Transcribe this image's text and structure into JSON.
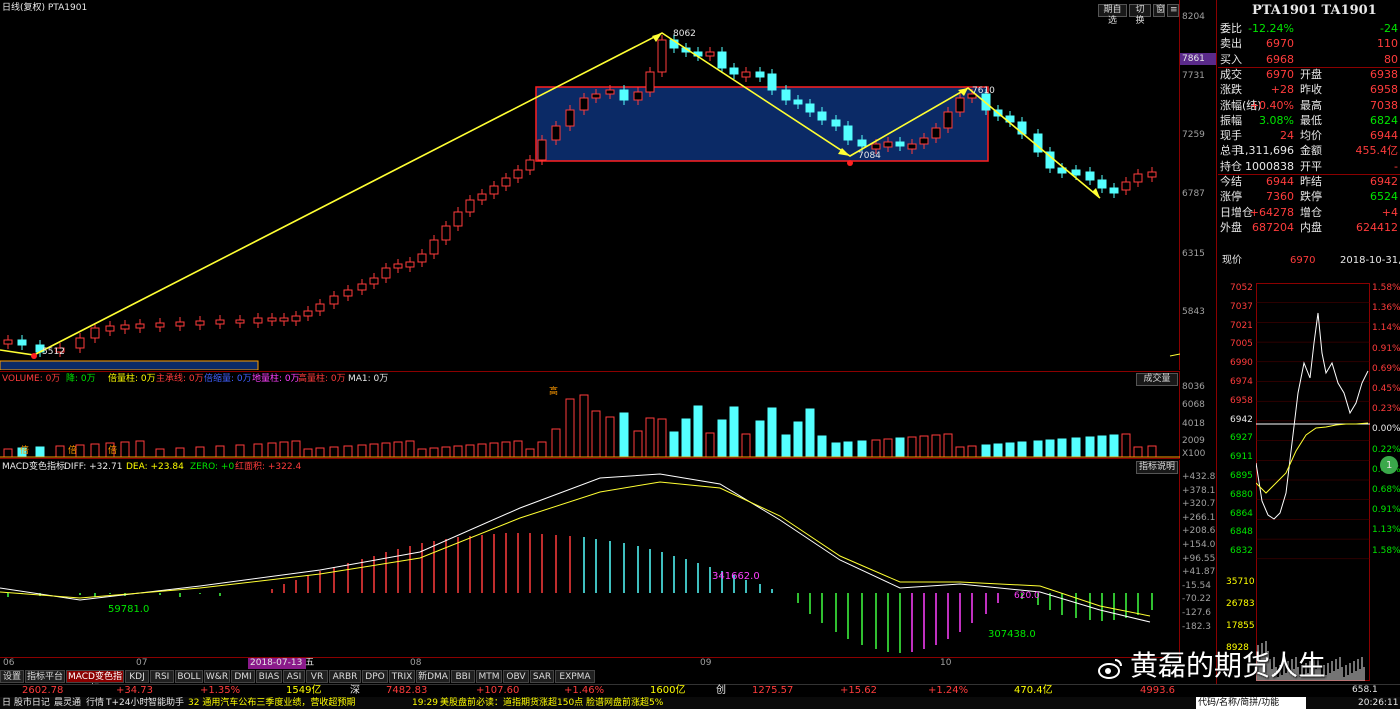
{
  "header": {
    "title": "日线(复权) PTA1901",
    "buttons": [
      "期自选",
      "切换",
      "窗"
    ]
  },
  "price_axis": [
    "8204",
    "7731",
    "7259",
    "6787",
    "6315",
    "5843"
  ],
  "price_current": "7861",
  "annotations": {
    "high": "8062",
    "low": "5512",
    "mid_low": "7084",
    "mid_high": "7610"
  },
  "volume": {
    "title": "VOLUME: 0万",
    "items": [
      "降: 0万",
      "倍量柱: 0万",
      "主承线: 0万",
      "倍缩量: 0万",
      "地量柱: 0万",
      "高量柱: 0万",
      "MA1: 0万"
    ],
    "button": "成交量",
    "axis": [
      "8036",
      "6068",
      "4018",
      "2009",
      "X100"
    ],
    "marks": {
      "beiliang": "倍",
      "gao": "高"
    }
  },
  "macd": {
    "title": "MACD变色指标",
    "diff": "DIFF: +32.71",
    "dea": "DEA: +23.84",
    "zero": "ZERO: +0",
    "hongji": "红面积: +322.4",
    "button": "指标说明",
    "axis": [
      "+432.8",
      "+378.1",
      "+320.7",
      "+266.1",
      "+208.6",
      "+154.0",
      "+96.55",
      "+41.87",
      "-15.54",
      "-70.22",
      "-127.6",
      "-182.3"
    ],
    "labels": {
      "a": "59781.0",
      "b": "341662.0",
      "c": "307438.0",
      "d": "620.0"
    }
  },
  "xaxis": [
    "06",
    "07",
    "08",
    "09",
    "10"
  ],
  "date_highlight": "2018-07-13 五",
  "tabs": [
    "设置",
    "指标平台",
    "MACD变色指标",
    "KDJ",
    "RSI",
    "BOLL",
    "W&R",
    "DMI",
    "BIAS",
    "ASI",
    "VR",
    "ARBR",
    "DPO",
    "TRIX",
    "新DMA",
    "BBI",
    "MTM",
    "OBV",
    "SAR",
    "EXPMA"
  ],
  "status": {
    "idx1": "2602.78",
    "chg1": "+34.73",
    "pct1": "+1.35%",
    "amt1": "1549亿",
    "mkt2": "深",
    "idx2": "7482.83",
    "chg2": "+107.60",
    "pct2": "+1.46%",
    "amt2": "1600亿",
    "mkt3": "创",
    "idx3": "1275.57",
    "chg3": "+15.62",
    "pct3": "+1.24%",
    "amt3": "470.4亿",
    "extra": "4993.6"
  },
  "news": {
    "items": [
      "日 股市日记",
      "晨灵通",
      "行情",
      "T+24小时",
      "智能助手"
    ],
    "msg1": "32 通用汽车公布三季度业绩，营收超预期",
    "time": "19:29",
    "msg2": "美股盘前必读：道指期货涨超150点 脸谱网盘前涨超5%"
  },
  "quote": {
    "title": "PTA1901 TA1901",
    "rows": [
      {
        "l": "委比",
        "v": "-12.24%",
        "r": "",
        "rv": "-24"
      },
      {
        "l": "卖出",
        "v": "6970",
        "r": "",
        "rv": "110"
      },
      {
        "l": "买入",
        "v": "6968",
        "r": "",
        "rv": "80"
      },
      {
        "l": "成交",
        "v": "6970",
        "r": "开盘",
        "rv": "6938"
      },
      {
        "l": "涨跌",
        "v": "+28",
        "r": "昨收",
        "rv": "6958"
      },
      {
        "l": "涨幅(结)",
        "v": "+0.40%",
        "r": "最高",
        "rv": "7038"
      },
      {
        "l": "振幅",
        "v": "3.08%",
        "r": "最低",
        "rv": "6824"
      },
      {
        "l": "现手",
        "v": "24",
        "r": "均价",
        "rv": "6944"
      },
      {
        "l": "总手",
        "v": "1,311,696",
        "r": "金额",
        "rv": "455.4亿"
      },
      {
        "l": "持仓",
        "v": "1000838",
        "r": "开平",
        "rv": "-"
      },
      {
        "l": "今结",
        "v": "6944",
        "r": "昨结",
        "rv": "6942"
      },
      {
        "l": "涨停",
        "v": "7360",
        "r": "跌停",
        "rv": "6524"
      },
      {
        "l": "日增仓",
        "v": "+64278",
        "r": "增仓",
        "rv": "+4"
      },
      {
        "l": "外盘",
        "v": "687204",
        "r": "内盘",
        "rv": "624412"
      }
    ]
  },
  "intraday": {
    "label": "现价",
    "price": "6970",
    "date": "2018-10-31,三",
    "left_axis": [
      "7052",
      "7037",
      "7021",
      "7005",
      "6990",
      "6974",
      "6958",
      "6942",
      "6927",
      "6911",
      "6895",
      "6880",
      "6864",
      "6848",
      "6832"
    ],
    "right_axis": [
      "1.58%",
      "1.36%",
      "1.14%",
      "0.91%",
      "0.69%",
      "0.45%",
      "0.23%",
      "0.00%",
      "0.22%",
      "0.45%",
      "0.68%",
      "0.91%",
      "1.13%",
      "1.58%"
    ],
    "vol_axis": [
      "35710",
      "26783",
      "17855",
      "8928"
    ],
    "badge": "1"
  },
  "bottom_right": {
    "tab": "代码/名称/简拼/功能",
    "time": "20:26:11",
    "price": "658.1"
  },
  "watermark": "黄磊的期货人生",
  "colors": {
    "up": "#ff3c3c",
    "down": "#54ffff",
    "box": "#0b2a66",
    "yellow": "#ffff33"
  }
}
